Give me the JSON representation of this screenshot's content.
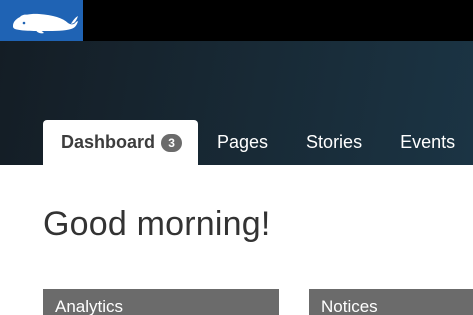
{
  "header": {
    "logo_icon": "whale-icon",
    "brand_color": "#1f63b4"
  },
  "tabs": [
    {
      "label": "Dashboard",
      "badge": "3",
      "active": true
    },
    {
      "label": "Pages"
    },
    {
      "label": "Stories"
    },
    {
      "label": "Events"
    }
  ],
  "main": {
    "greeting": "Good morning!"
  },
  "panels": {
    "analytics_title": "Analytics",
    "notices_title": "Notices"
  }
}
